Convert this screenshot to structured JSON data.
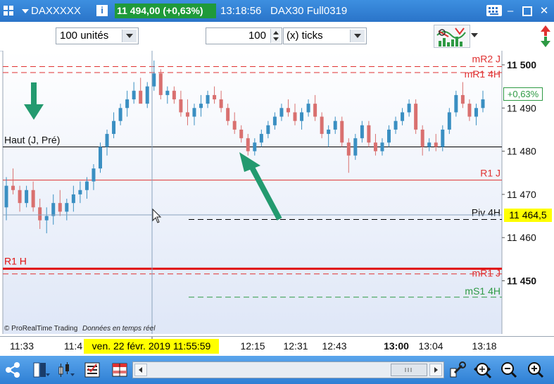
{
  "titlebar": {
    "symbol": "DAXXXXX",
    "info_icon": "i",
    "price_change": "11 494,00 (+0,63%)",
    "time": "13:18:56",
    "contract": "DAX30 Full0319"
  },
  "toolbar": {
    "quantity": "100 unités",
    "tick_count": "100",
    "tick_unit": "(x) ticks"
  },
  "chart": {
    "levels": [
      {
        "label": "mR2 J",
        "price": 11499.6,
        "color": "#e03131",
        "style": "dashed"
      },
      {
        "label": "mR1 4H",
        "price": 11498.2,
        "color": "#e03131",
        "style": "dashed"
      },
      {
        "label": "Haut (J, Pré)",
        "price": 11481.0,
        "color": "#000000",
        "style": "solid"
      },
      {
        "label": "R1 J",
        "price": 11473.3,
        "color": "#e03131",
        "style": "solid"
      },
      {
        "label": "Piv 4H",
        "price": 11464.2,
        "color": "#000000",
        "style": "dashed"
      },
      {
        "label": "R1 H",
        "price": 11452.8,
        "color": "#e01010",
        "style": "thick"
      },
      {
        "label": "mR1 J",
        "price": 11451.6,
        "color": "#e03131",
        "style": "dashed"
      },
      {
        "label": "mS1 4H",
        "price": 11446.2,
        "color": "#2e9a44",
        "style": "dashed"
      }
    ],
    "y_ticks": [
      "11 500",
      "11 490",
      "11 480",
      "11 470",
      "11 460",
      "11 450"
    ],
    "y_tick_values": [
      11500,
      11490,
      11480,
      11470,
      11460,
      11450
    ],
    "x_ticks": [
      "11:33",
      "11:4",
      "12:15",
      "12:31",
      "12:43",
      "13:00",
      "13:04",
      "13:18"
    ],
    "current_badge": "+0,63%",
    "cursor_price": "11 464,5",
    "cursor_time": "ven. 22 févr. 2019 11:55:59",
    "watermark": "© ProRealTime Trading",
    "watermark_note": "Données en temps réel",
    "colors": {
      "up": "#3a8fc2",
      "down": "#d9706f",
      "cursor_bg": "#ffff00",
      "badge": "#2e9a44"
    },
    "candles": [
      [
        11467,
        11474,
        11464,
        11472
      ],
      [
        11472,
        11476,
        11470,
        11471
      ],
      [
        11471,
        11472,
        11466,
        11468
      ],
      [
        11468,
        11472,
        11467,
        11471
      ],
      [
        11471,
        11473,
        11466,
        11467
      ],
      [
        11467,
        11469,
        11462,
        11464
      ],
      [
        11464,
        11467,
        11461,
        11465
      ],
      [
        11465,
        11470,
        11463,
        11468
      ],
      [
        11468,
        11471,
        11465,
        11466
      ],
      [
        11466,
        11469,
        11464,
        11468
      ],
      [
        11468,
        11472,
        11466,
        11470
      ],
      [
        11470,
        11473,
        11468,
        11471
      ],
      [
        11471,
        11474,
        11469,
        11473
      ],
      [
        11473,
        11477,
        11471,
        11476
      ],
      [
        11476,
        11482,
        11475,
        11481
      ],
      [
        11481,
        11485,
        11479,
        11484
      ],
      [
        11484,
        11489,
        11483,
        11487
      ],
      [
        11487,
        11491,
        11486,
        11490
      ],
      [
        11490,
        11494,
        11488,
        11492
      ],
      [
        11492,
        11496,
        11491,
        11494
      ],
      [
        11494,
        11497,
        11492,
        11491
      ],
      [
        11491,
        11496,
        11490,
        11495
      ],
      [
        11495,
        11501,
        11494,
        11498
      ],
      [
        11498,
        11499,
        11492,
        11493
      ],
      [
        11493,
        11495,
        11491,
        11494
      ],
      [
        11494,
        11495,
        11491,
        11492
      ],
      [
        11492,
        11494,
        11488,
        11489
      ],
      [
        11489,
        11492,
        11486,
        11488
      ],
      [
        11488,
        11491,
        11486,
        11490
      ],
      [
        11490,
        11493,
        11488,
        11491
      ],
      [
        11491,
        11494,
        11490,
        11493
      ],
      [
        11493,
        11495,
        11491,
        11492
      ],
      [
        11492,
        11494,
        11489,
        11490
      ],
      [
        11490,
        11491,
        11486,
        11487
      ],
      [
        11487,
        11489,
        11484,
        11485
      ],
      [
        11485,
        11486,
        11482,
        11483
      ],
      [
        11483,
        11484,
        11479,
        11480
      ],
      [
        11480,
        11483,
        11479,
        11482
      ],
      [
        11482,
        11485,
        11481,
        11484
      ],
      [
        11484,
        11487,
        11483,
        11486
      ],
      [
        11486,
        11489,
        11485,
        11488
      ],
      [
        11488,
        11491,
        11487,
        11490
      ],
      [
        11490,
        11492,
        11488,
        11489
      ],
      [
        11489,
        11491,
        11486,
        11487
      ],
      [
        11487,
        11490,
        11485,
        11489
      ],
      [
        11489,
        11492,
        11488,
        11491
      ],
      [
        11491,
        11493,
        11487,
        11488
      ],
      [
        11488,
        11489,
        11483,
        11484
      ],
      [
        11484,
        11486,
        11481,
        11485
      ],
      [
        11485,
        11488,
        11484,
        11487
      ],
      [
        11487,
        11488,
        11481,
        11482
      ],
      [
        11482,
        11483,
        11475,
        11479
      ],
      [
        11479,
        11484,
        11478,
        11483
      ],
      [
        11483,
        11487,
        11482,
        11486
      ],
      [
        11486,
        11487,
        11481,
        11482
      ],
      [
        11482,
        11484,
        11479,
        11480
      ],
      [
        11480,
        11483,
        11479,
        11482
      ],
      [
        11482,
        11486,
        11481,
        11485
      ],
      [
        11485,
        11488,
        11484,
        11487
      ],
      [
        11487,
        11490,
        11486,
        11489
      ],
      [
        11489,
        11492,
        11488,
        11491
      ],
      [
        11491,
        11492,
        11484,
        11485
      ],
      [
        11485,
        11486,
        11479,
        11481
      ],
      [
        11481,
        11483,
        11480,
        11482
      ],
      [
        11482,
        11484,
        11480,
        11481
      ],
      [
        11481,
        11486,
        11480,
        11485
      ],
      [
        11485,
        11490,
        11484,
        11489
      ],
      [
        11489,
        11494,
        11488,
        11493
      ],
      [
        11493,
        11496,
        11490,
        11491
      ],
      [
        11491,
        11492,
        11487,
        11488
      ],
      [
        11488,
        11491,
        11486,
        11490
      ],
      [
        11490,
        11494,
        11489,
        11492
      ]
    ]
  },
  "statusbar": {
    "icons": [
      "share-icon",
      "layout-icon",
      "candles-icon",
      "list-icon",
      "grid-icon",
      "scroll-left-icon",
      "scroll-right-icon",
      "wrench-icon",
      "zoom-fit-icon",
      "zoom-out-icon",
      "zoom-in-icon"
    ]
  }
}
